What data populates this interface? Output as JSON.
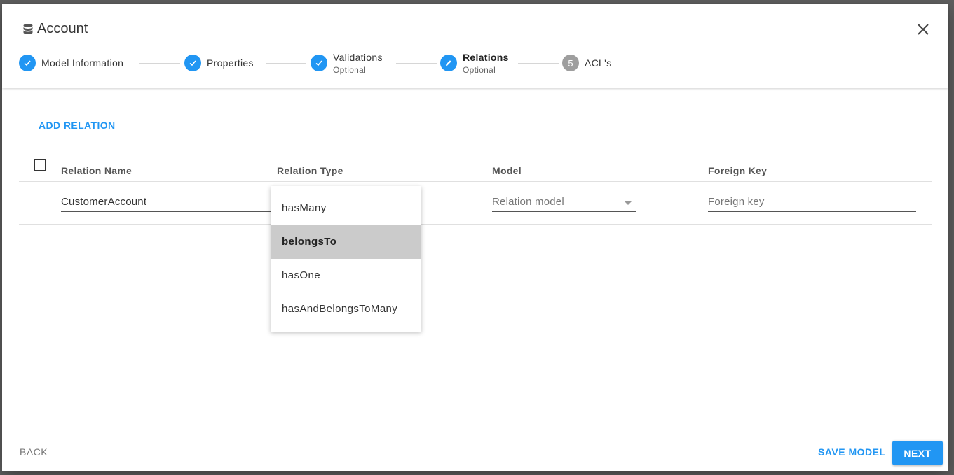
{
  "dialog": {
    "title": "Account",
    "title_icon": "database-icon",
    "close_icon": "close-icon"
  },
  "stepper": {
    "steps": [
      {
        "label": "Model Information",
        "sub": "",
        "state": "done"
      },
      {
        "label": "Properties",
        "sub": "",
        "state": "done"
      },
      {
        "label": "Validations",
        "sub": "Optional",
        "state": "done"
      },
      {
        "label": "Relations",
        "sub": "Optional",
        "state": "editing"
      },
      {
        "label": "ACL's",
        "sub": "",
        "state": "pending",
        "number": "5"
      }
    ]
  },
  "relations": {
    "add_label": "ADD RELATION",
    "columns": [
      "Relation Name",
      "Relation Type",
      "Model",
      "Foreign Key"
    ],
    "row": {
      "name": "CustomerAccount",
      "model_placeholder": "Relation model",
      "foreign_key_placeholder": "Foreign key"
    }
  },
  "type_menu": {
    "options": [
      "hasMany",
      "belongsTo",
      "hasOne",
      "hasAndBelongsToMany"
    ],
    "selected": "belongsTo"
  },
  "footer": {
    "back_label": "BACK",
    "save_label": "SAVE MODEL",
    "next_label": "NEXT"
  },
  "colors": {
    "accent": "#2196f3",
    "pending_step": "#9e9e9e",
    "selected_option_bg": "#cbcbcb"
  }
}
